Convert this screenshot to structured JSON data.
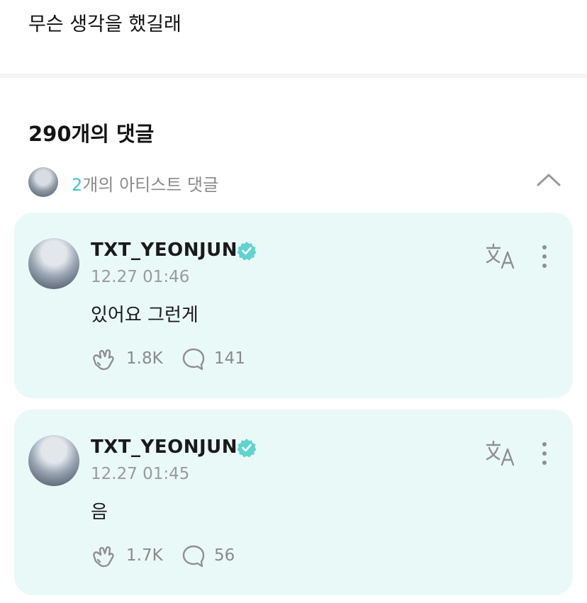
{
  "post": {
    "text": "무슨 생각을 했길래"
  },
  "comments_section": {
    "title": "290개의 댓글",
    "artist_row": {
      "count": "2",
      "label_suffix": "개의 아티스트 댓글",
      "toggle_icon": "chevron-up-icon"
    }
  },
  "comments": [
    {
      "author": "TXT_YEONJUN",
      "verified": true,
      "time": "12.27 01:46",
      "text": "있어요 그런게",
      "likes": "1.8K",
      "replies": "141"
    },
    {
      "author": "TXT_YEONJUN",
      "verified": true,
      "time": "12.27 01:45",
      "text": "음",
      "likes": "1.7K",
      "replies": "56"
    }
  ],
  "colors": {
    "accent": "#3fc7c7",
    "card_bg": "#e9f9f7",
    "verified": "#5fd3d0",
    "muted_text": "#8a8a8a"
  },
  "icons": [
    "translate-icon",
    "more-vertical-icon",
    "cheer-hand-icon",
    "reply-bubble-icon",
    "verified-badge-icon",
    "chevron-up-icon"
  ]
}
